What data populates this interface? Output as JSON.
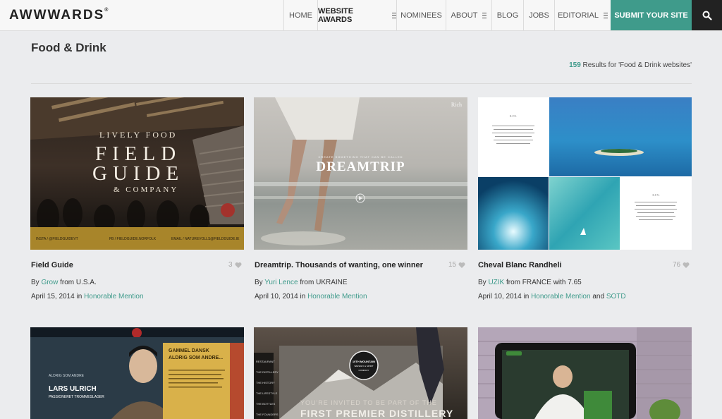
{
  "header": {
    "logo": "AWWWARDS",
    "logo_mark": "®",
    "nav": [
      {
        "label": "HOME"
      },
      {
        "label": "WEBSITE AWARDS"
      },
      {
        "label": "NOMINEES"
      },
      {
        "label": "ABOUT"
      },
      {
        "label": "BLOG"
      },
      {
        "label": "JOBS"
      },
      {
        "label": "EDITORIAL"
      }
    ],
    "submit_label": "SUBMIT YOUR SITE",
    "search_icon": "search-icon"
  },
  "page": {
    "title": "Food & Drink",
    "results_count": "159",
    "results_text": " Results for 'Food & Drink websites'"
  },
  "cards": [
    {
      "title": "Field Guide",
      "likes": "3",
      "by": "By ",
      "author": "Grow",
      "from": " from ",
      "country": "U.S.A.",
      "with": "",
      "score": "",
      "date": "April 15, 2014",
      "in": " in ",
      "award": "Honorable Mention",
      "and": "",
      "award2": "",
      "thumb": {
        "line1": "LIVELY FOOD",
        "line2": "FIELD",
        "line3": "GUIDE",
        "line4": "& COMPANY",
        "foot1": "INSTA / @FIELDGUIDEVT",
        "foot2": "FB / FIELDGUIDE.NORFOLK",
        "foot3": "EMAIL / NATUREVOLLS@FIELDGUIDE.IE"
      }
    },
    {
      "title": "Dreamtrip. Thousands of wanting, one winner",
      "likes": "15",
      "by": "By ",
      "author": "Yuri Lence",
      "from": " from ",
      "country": "UKRAINE",
      "with": "",
      "score": "",
      "date": "April 10, 2014",
      "in": " in ",
      "award": "Honorable Mention",
      "and": "",
      "award2": "",
      "thumb": {
        "corner": "Rich",
        "tagline": "CREATE SOMETHING THAT CAN BE CALLED",
        "word": "DREAMTRIP"
      }
    },
    {
      "title": "Cheval Blanc Randheli",
      "likes": "76",
      "by": "By ",
      "author": "UZIK",
      "from": " from ",
      "country": "FRANCE",
      "with": " with ",
      "score": "7.65",
      "date": "April 10, 2014",
      "in": " in ",
      "award": "Honorable Mention",
      "and": " and ",
      "award2": "SOTD",
      "thumb": {
        "heading": "R.P.N."
      }
    },
    {
      "thumb": {
        "name1": "LARS ULRICH",
        "name2": "PASSIONERET TROMMESLAGER",
        "kicker": "ALDRIG SOM ANDRE",
        "box1": "GAMMEL DANSK",
        "box2": "ALDRIG SOM ANDRE..."
      }
    },
    {
      "thumb": {
        "menu": [
          "RESTAURANT",
          "THE DISTILLERY",
          "THE HISTORY",
          "THE LIFESTYLE",
          "THE BOTTLES",
          "THE FOUNDERS"
        ],
        "badge1": "10TH MOUNTAIN",
        "badge2": "WHISKEY & SPIRIT",
        "badge3": "COMPANY",
        "line1": "YOU'RE INVITED TO BE PART OF THE",
        "line2": "FIRST PREMIER DISTILLERY"
      }
    },
    {
      "thumb": {}
    }
  ],
  "colors": {
    "accent": "#3f9b8b",
    "dark": "#222222"
  }
}
